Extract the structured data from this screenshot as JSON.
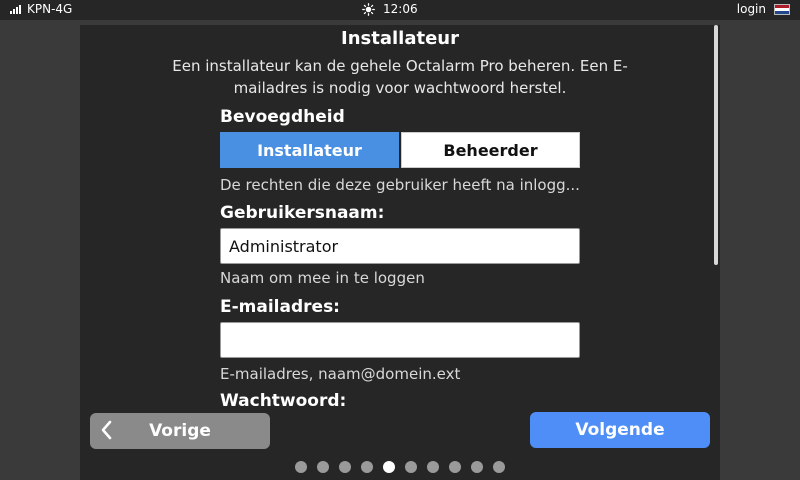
{
  "statusbar": {
    "carrier": "KPN-4G",
    "time": "12:06",
    "login_label": "login",
    "signal_icon": "signal-icon",
    "brightness_icon": "sun-icon",
    "flag_icon": "flag-nl-icon",
    "flag_colors": [
      "#ae1c28",
      "#ffffff",
      "#21468b"
    ]
  },
  "page": {
    "title": "Installateur",
    "description": "Een installateur kan de gehele Octalarm Pro beheren. Een E-mailadres is nodig voor wachtwoord herstel."
  },
  "role": {
    "label": "Bevoegdheid",
    "options": [
      "Installateur",
      "Beheerder"
    ],
    "selected": "Installateur",
    "hint": "De rechten die deze gebruiker heeft na inlogg..."
  },
  "username": {
    "label": "Gebruikersnaam:",
    "value": "Administrator",
    "hint": "Naam om mee in te loggen"
  },
  "email": {
    "label": "E-mailadres:",
    "value": "",
    "hint": "E-mailadres, naam@domein.ext"
  },
  "password": {
    "label": "Wachtwoord:"
  },
  "nav": {
    "prev_label": "Vorige",
    "next_label": "Volgende",
    "prev_icon": "chevron-left-icon"
  },
  "pager": {
    "total": 10,
    "current": 5
  },
  "colors": {
    "accent": "#4a90e2",
    "next_button": "#4f8ef7",
    "prev_button": "#8a8a8a",
    "panel": "#262626",
    "background": "#3a3a3a"
  }
}
